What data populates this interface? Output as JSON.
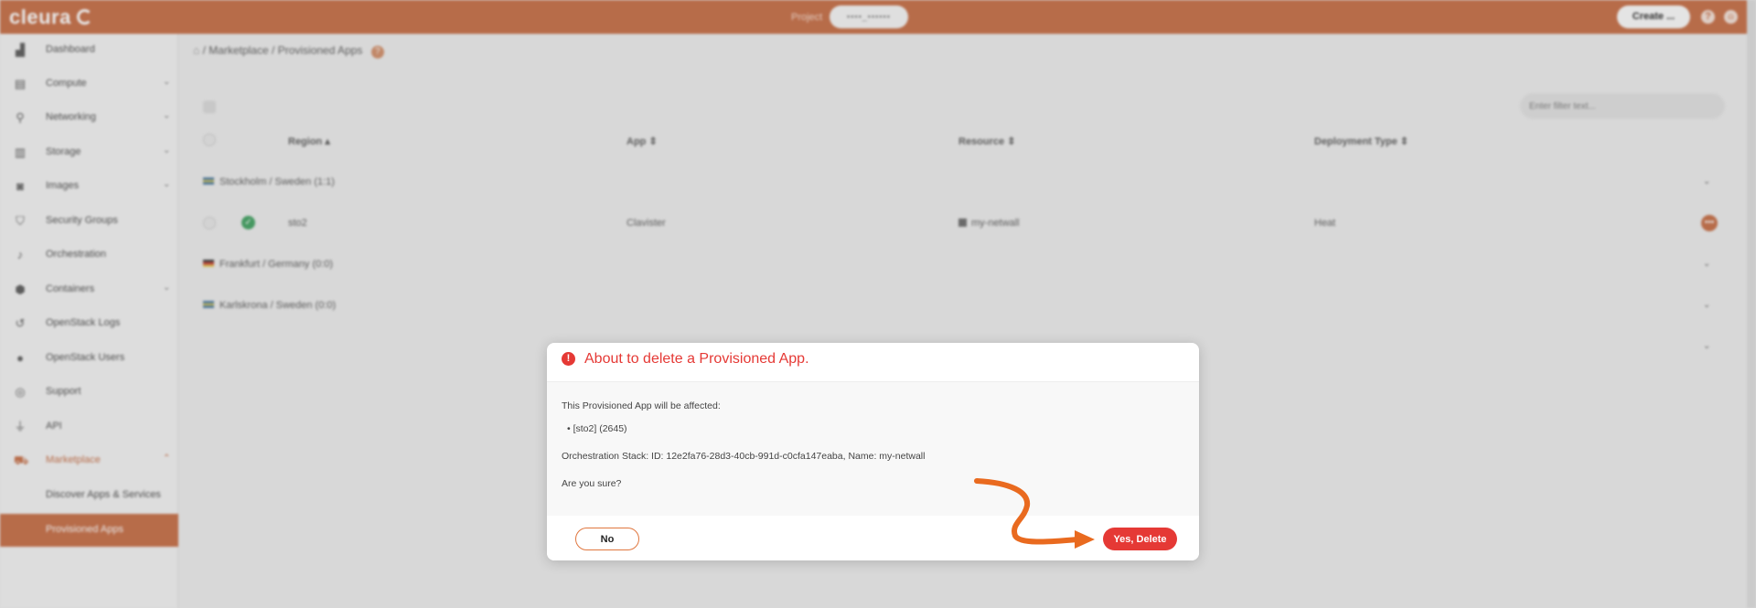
{
  "topbar": {
    "logo": "cleura",
    "project_label": "Project",
    "project_value": "▪▪▪▪_▪▪▪▪▪▪",
    "create_label": "Create ...",
    "help_glyph": "?",
    "user_glyph": "⍝"
  },
  "sidebar": {
    "items": [
      {
        "label": "Dashboard",
        "icon": "dashboard-icon",
        "glyph": "▟"
      },
      {
        "label": "Compute",
        "icon": "compute-icon",
        "glyph": "▤"
      },
      {
        "label": "Networking",
        "icon": "networking-icon",
        "glyph": "⚲"
      },
      {
        "label": "Storage",
        "icon": "storage-icon",
        "glyph": "▥"
      },
      {
        "label": "Images",
        "icon": "camera-icon",
        "glyph": "◙"
      },
      {
        "label": "Security Groups",
        "icon": "shield-icon",
        "glyph": "⛉"
      },
      {
        "label": "Orchestration",
        "icon": "orchestration-icon",
        "glyph": "♪"
      },
      {
        "label": "Containers",
        "icon": "containers-icon",
        "glyph": "⬢"
      },
      {
        "label": "OpenStack Logs",
        "icon": "history-icon",
        "glyph": "↺"
      },
      {
        "label": "OpenStack Users",
        "icon": "user-icon",
        "glyph": "●"
      },
      {
        "label": "Support",
        "icon": "support-icon",
        "glyph": "◎"
      },
      {
        "label": "API",
        "icon": "plug-icon",
        "glyph": "⏚"
      },
      {
        "label": "Marketplace",
        "icon": "cart-icon",
        "glyph": "⛟"
      }
    ],
    "sub_items": [
      {
        "label": "Discover Apps & Services"
      },
      {
        "label": "Provisioned Apps"
      }
    ],
    "chevron_down": "⌄",
    "chevron_up": "⌃"
  },
  "breadcrumb": {
    "home": "⌂",
    "sep": "/",
    "items": [
      "Marketplace",
      "Provisioned Apps"
    ],
    "help": "?"
  },
  "filter": {
    "placeholder": "Enter filter text..."
  },
  "table": {
    "headers": [
      "Region ▴",
      "App ⇕",
      "Resource ⇕",
      "Deployment Type ⇕"
    ],
    "groups": [
      {
        "label": "Stockholm / Sweden (1:1)"
      },
      {
        "label": "Frankfurt / Germany (0:0)"
      },
      {
        "label": "Karlskrona / Sweden (0:0)"
      }
    ],
    "row": {
      "region": "sto2",
      "app": "Clavister",
      "resource": "my-netwall",
      "deployment_type": "Heat",
      "status_glyph": "✓",
      "action_glyph": "•••"
    },
    "chevron": "⌄"
  },
  "modal": {
    "alert_glyph": "!",
    "title": "About to delete a Provisioned App.",
    "affected_text": "This Provisioned App will be affected:",
    "item": "[sto2] (2645)",
    "stack_text": "Orchestration Stack: ID: 12e2fa76-28d3-40cb-991d-c0cfa147eaba, Name: my-netwall",
    "question": "Are you sure?",
    "no_label": "No",
    "yes_label": "Yes, Delete"
  },
  "colors": {
    "brand": "#c4683e",
    "danger": "#e53935",
    "annotation_arrow": "#e96a1f"
  }
}
